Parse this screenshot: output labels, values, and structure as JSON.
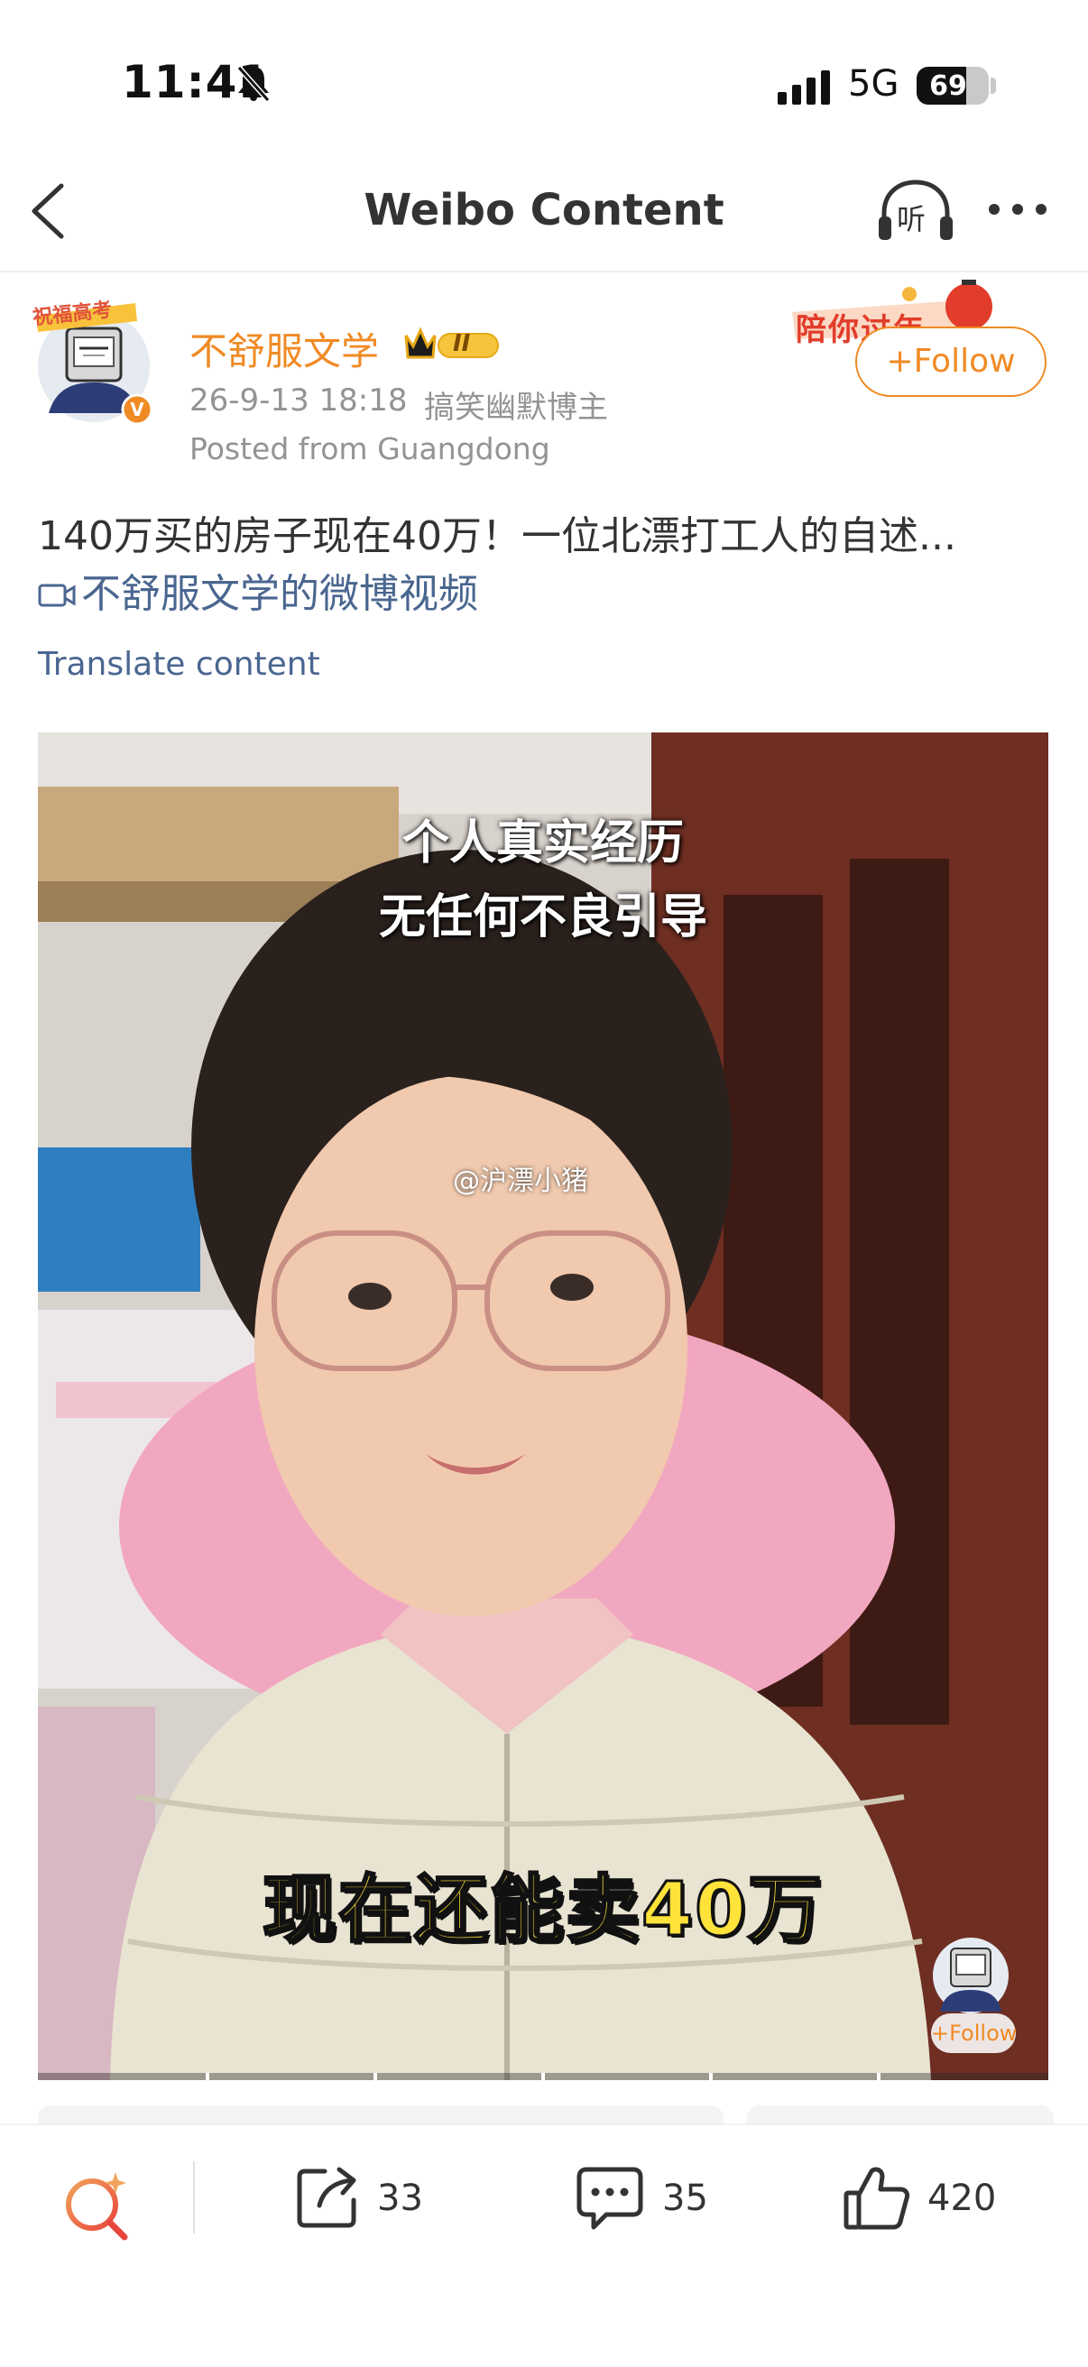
{
  "status_bar": {
    "time": "11:41",
    "network": "5G",
    "battery": "69",
    "battery_level": 0.69
  },
  "nav": {
    "title": "Weibo Content",
    "listen_label": "听"
  },
  "author": {
    "name": "不舒服文学",
    "vip_level": "II",
    "post_time": "26-9-13 18:18",
    "tag": "搞笑幽默博主",
    "location": "Posted from Guangdong",
    "follow_label": "+Follow",
    "promo_text": "陪你过年",
    "avatar_tag": "祝福高考"
  },
  "post": {
    "text": "140万买的房子现在40万！一位北漂打工人的自述...",
    "video_link": "不舒服文学的微博视频",
    "translate_label": "Translate content"
  },
  "video": {
    "caption_top_line1": "个人真实经历",
    "caption_top_line2": "无任何不良引导",
    "watermark": "@沪漂小猪",
    "caption_bottom": "现在还能卖40万",
    "mini_follow": "+Follow"
  },
  "actions": {
    "shares": "33",
    "comments": "35",
    "likes": "420"
  },
  "colors": {
    "accent": "#f08a24",
    "link": "#4a6690",
    "ai_search": "#e8463c"
  }
}
